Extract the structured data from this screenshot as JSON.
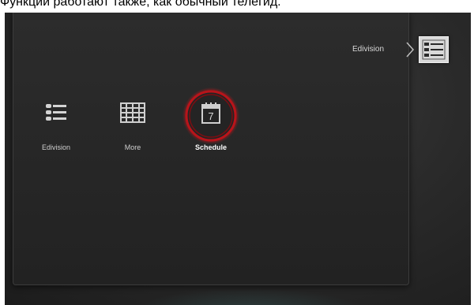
{
  "caption": "Функции работают также, как обычный телегид.",
  "breadcrumb": {
    "label": "Edivision",
    "icon": "list-menu-icon"
  },
  "menu": {
    "items": [
      {
        "label": "Edivision",
        "icon": "list-menu-icon",
        "selected": false
      },
      {
        "label": "More",
        "icon": "grid-table-icon",
        "selected": false
      },
      {
        "label": "Schedule",
        "icon": "calendar-icon",
        "calendar_day": "7",
        "selected": true
      }
    ]
  },
  "colors": {
    "background": "#262626",
    "selection_ring": "#c0161c",
    "label_text": "#cfcfcf",
    "selected_text": "#ffffff"
  }
}
